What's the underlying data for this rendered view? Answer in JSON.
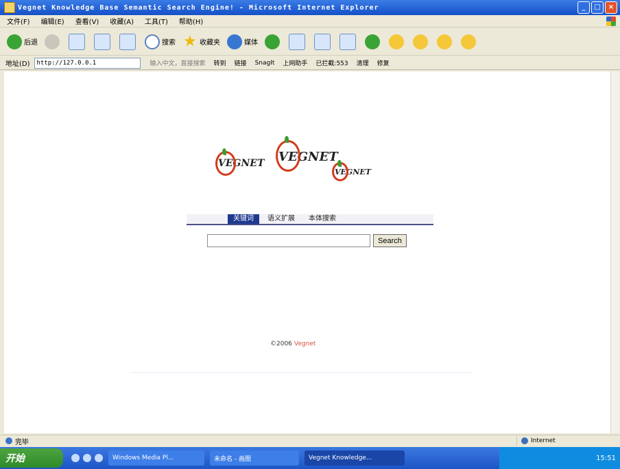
{
  "window": {
    "title": "Vegnet Knowledge Base Semantic Search Engine! - Microsoft Internet Explorer",
    "controls": [
      "_",
      "□",
      "×"
    ]
  },
  "menubar": {
    "items": [
      "文件(F)",
      "编辑(E)",
      "查看(V)",
      "收藏(A)",
      "工具(T)",
      "帮助(H)"
    ]
  },
  "toolbar": {
    "back_label": "后退",
    "search_label": "搜索",
    "favorites_label": "收藏夹",
    "media_label": "媒体"
  },
  "addressbar": {
    "label": "地址(D)",
    "url": "http://127.0.0.1",
    "search_hint": "输入中文，直接搜索",
    "go_label": "转到",
    "links_label": "链接",
    "snagit_label": "SnagIt",
    "assistant_label": "上网助手",
    "blocked_label": "已拦截:553",
    "clean_label": "清理",
    "repair_label": "修复"
  },
  "page": {
    "logos": [
      "VEGNET",
      "VEGNET",
      "VEGNET"
    ],
    "tabs": [
      {
        "label": "关键词",
        "active": true
      },
      {
        "label": "语义扩展",
        "active": false
      },
      {
        "label": "本体搜索",
        "active": false
      }
    ],
    "search_value": "",
    "search_button": "Search",
    "copyright_prefix": "©2006",
    "copyright_brand": "Vegnet"
  },
  "statusbar": {
    "text": "完毕",
    "zone": "Internet"
  },
  "taskbar": {
    "start_label": "开始",
    "tasks": [
      {
        "label": "Windows Media Pl...",
        "active": false
      },
      {
        "label": "未命名 - 画图",
        "active": false
      },
      {
        "label": "Vegnet Knowledge...",
        "active": true
      }
    ],
    "clock": "15:51"
  },
  "colors": {
    "titlebar": "#1650c8",
    "tab_active": "#1e3a8f",
    "logo_accent": "#d23a1c",
    "brand_text": "#d64f3f"
  }
}
